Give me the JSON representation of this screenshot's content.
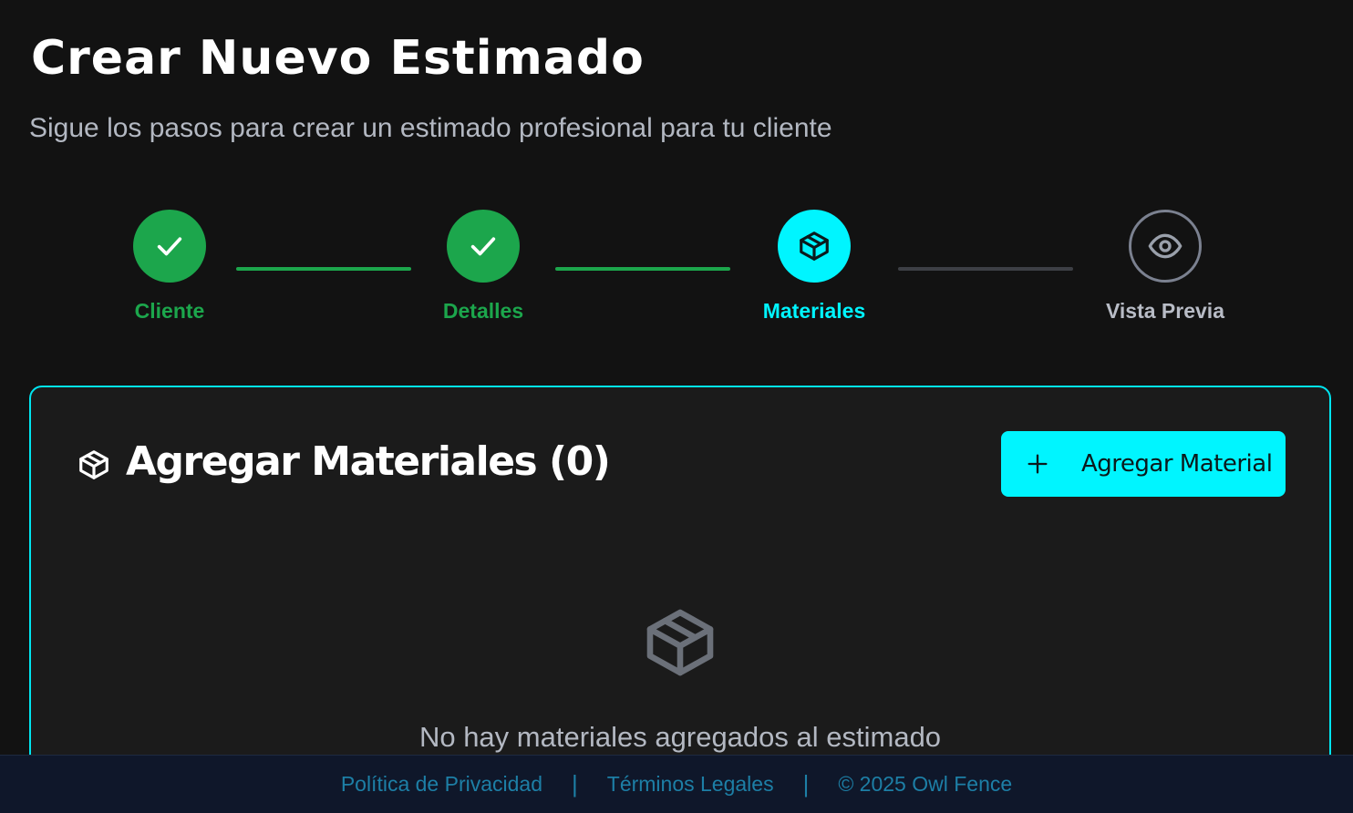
{
  "header": {
    "title": "Crear Nuevo Estimado",
    "subtitle": "Sigue los pasos para crear un estimado profesional para tu cliente"
  },
  "stepper": {
    "steps": [
      {
        "label": "Cliente",
        "state": "done",
        "icon": "check-icon"
      },
      {
        "label": "Detalles",
        "state": "done",
        "icon": "check-icon"
      },
      {
        "label": "Materiales",
        "state": "active",
        "icon": "package-icon"
      },
      {
        "label": "Vista Previa",
        "state": "pending",
        "icon": "eye-icon"
      }
    ]
  },
  "materials": {
    "title": "Agregar Materiales (0)",
    "add_button_label": "Agregar Material",
    "empty_message": "No hay materiales agregados al estimado"
  },
  "footer": {
    "privacy_link": "Política de Privacidad",
    "terms_link": "Términos Legales",
    "separator": "|",
    "copyright": "© 2025 Owl Fence"
  },
  "colors": {
    "accent": "#00f5ff",
    "success": "#1ca64c",
    "background": "#121212",
    "card": "#1b1b1b",
    "footer": "#0f172a",
    "link": "#1d7fa6"
  }
}
